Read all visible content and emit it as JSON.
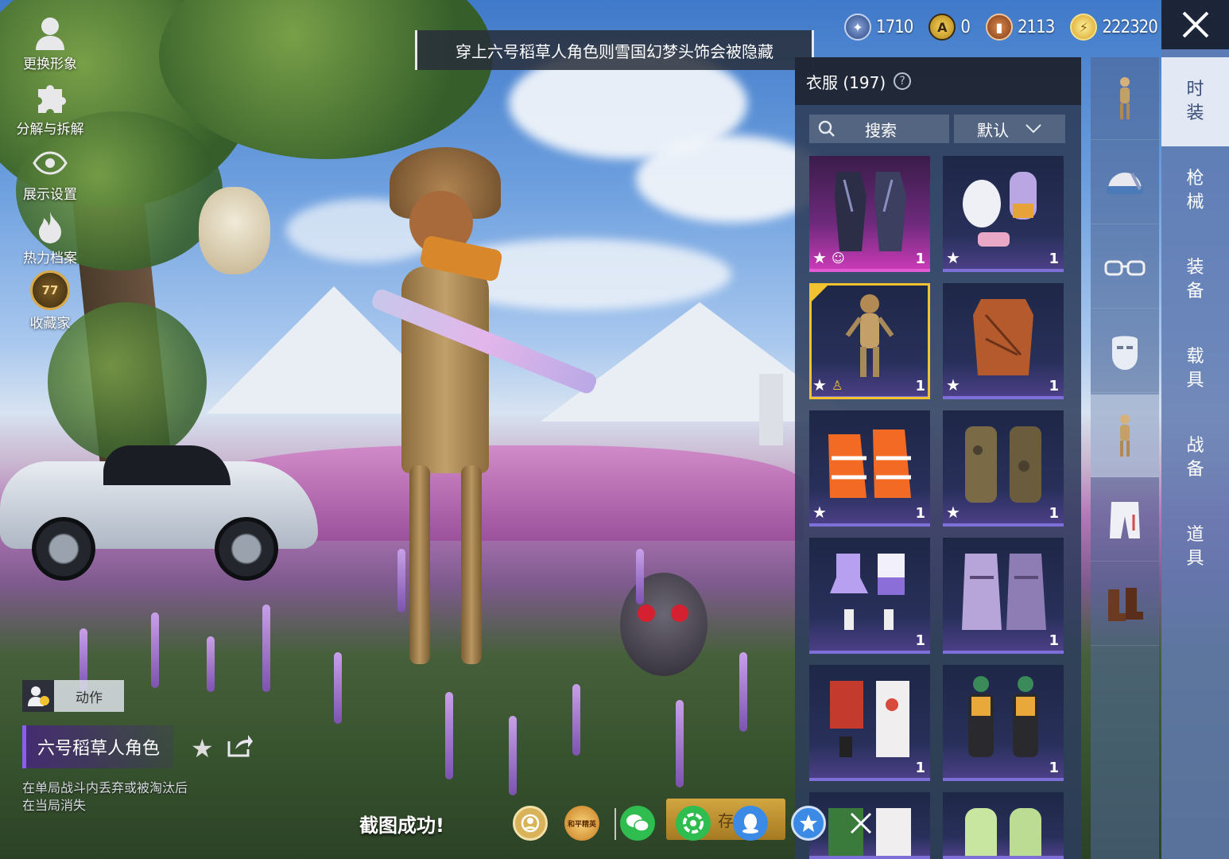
{
  "left_menu": [
    {
      "label": "更换形象",
      "icon": "avatar-silhouette-icon"
    },
    {
      "label": "分解与拆解",
      "icon": "puzzle-icon"
    },
    {
      "label": "展示设置",
      "icon": "eye-icon"
    },
    {
      "label": "热力档案",
      "icon": "flame-icon"
    },
    {
      "label": "收藏家",
      "icon": "collector-badge-icon",
      "badge_text": "77"
    }
  ],
  "banner": {
    "text": "穿上六号稻草人角色则雪国幻梦头饰会被隐藏"
  },
  "currencies": [
    {
      "name": "silver-coin",
      "value": "1710",
      "color": "#3a5ea8"
    },
    {
      "name": "gold-token",
      "value": "0",
      "color": "#e2b22a"
    },
    {
      "name": "bronze-coin",
      "value": "2113",
      "color": "#b5652b"
    },
    {
      "name": "energy-coin",
      "value": "222320",
      "color": "#e7c03a"
    }
  ],
  "inventory": {
    "title": "衣服 (197)",
    "help": "?",
    "search_label": "搜索",
    "sort_label": "默认",
    "items": [
      {
        "name": "dark-knight-outfit",
        "qty": "1",
        "star": "★",
        "rarity": "legendary"
      },
      {
        "name": "white-bear-suit",
        "qty": "1",
        "star": "★",
        "rarity": "epic"
      },
      {
        "name": "scarecrow-character",
        "qty": "1",
        "star": "★",
        "rarity": "epic",
        "selected": true
      },
      {
        "name": "orange-leather-vest",
        "qty": "1",
        "star": "★",
        "rarity": "epic"
      },
      {
        "name": "orange-hooded-suit",
        "qty": "1",
        "star": "★",
        "rarity": "epic"
      },
      {
        "name": "camo-tactical-suit",
        "qty": "1",
        "star": "★",
        "rarity": "epic"
      },
      {
        "name": "purple-cheerleader-set",
        "qty": "1",
        "star": "",
        "rarity": "epic"
      },
      {
        "name": "violet-ghost-outfit",
        "qty": "1",
        "star": "",
        "rarity": "epic"
      },
      {
        "name": "red-floral-outfit",
        "qty": "1",
        "star": "",
        "rarity": "epic"
      },
      {
        "name": "cyber-mask-outfit",
        "qty": "1",
        "star": "",
        "rarity": "epic"
      },
      {
        "name": "green-apron-outfit",
        "qty": "",
        "star": "",
        "rarity": "epic"
      },
      {
        "name": "lime-puffer-suit",
        "qty": "",
        "star": "",
        "rarity": "epic"
      }
    ]
  },
  "categories": [
    {
      "name": "full-body-figure-icon",
      "active": false
    },
    {
      "name": "helmet-icon",
      "active": false
    },
    {
      "name": "glasses-icon",
      "active": false
    },
    {
      "name": "mask-icon",
      "active": false
    },
    {
      "name": "outfit-figure-icon",
      "active": true
    },
    {
      "name": "pants-icon",
      "active": false
    },
    {
      "name": "boots-icon",
      "active": false
    }
  ],
  "main_tabs": [
    {
      "label": "时装",
      "active": true
    },
    {
      "label": "枪械",
      "active": false
    },
    {
      "label": "装备",
      "active": false
    },
    {
      "label": "载具",
      "active": false
    },
    {
      "label": "战备",
      "active": false
    },
    {
      "label": "道具",
      "active": false
    }
  ],
  "bottom": {
    "action_label": "动作",
    "item_name": "六号稻草人角色",
    "desc_line1": "在单局战斗内丢弃或被淘汰后",
    "desc_line2": "在当局消失",
    "screenshot_text": "截图成功!",
    "save_label": "存",
    "peace_elite_label": "和平精英"
  }
}
